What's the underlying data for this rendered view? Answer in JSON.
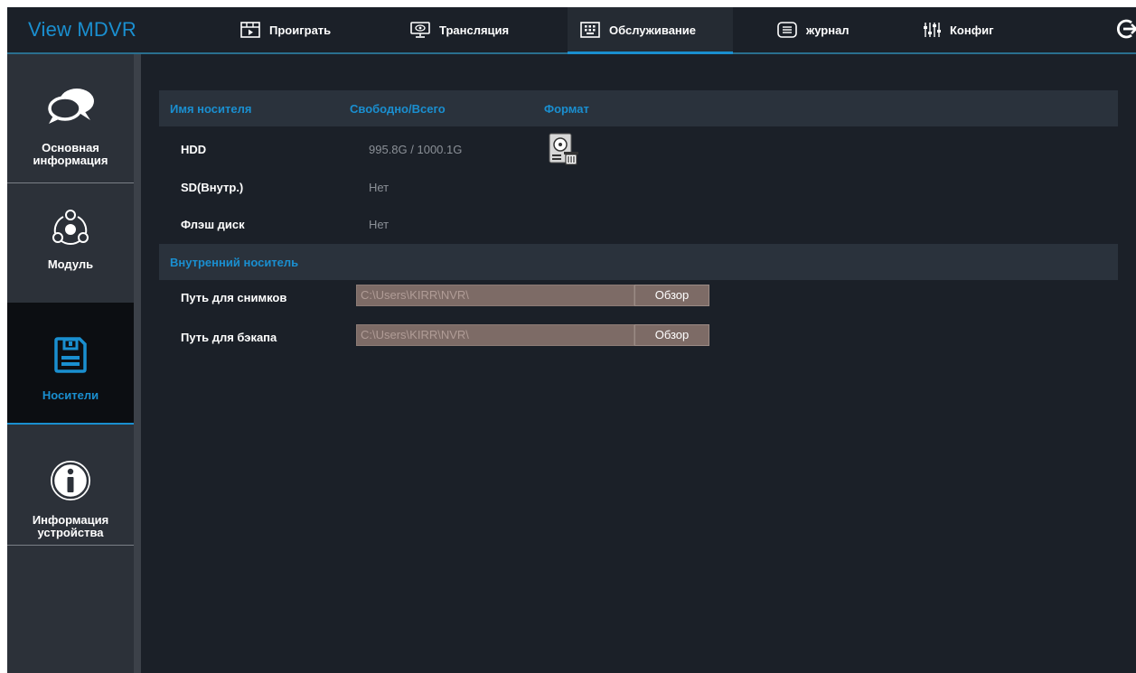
{
  "app": {
    "title": "View MDVR"
  },
  "nav": [
    {
      "label": "Проиграть",
      "icon": "play-film-icon"
    },
    {
      "label": "Трансляция",
      "icon": "monitor-icon"
    },
    {
      "label": "Обслуживание",
      "icon": "maintenance-grid-icon",
      "active": true
    },
    {
      "label": "журнал",
      "icon": "log-list-icon"
    },
    {
      "label": "Конфиг",
      "icon": "sliders-icon"
    }
  ],
  "sidebar": [
    {
      "label_line1": "Основная",
      "label_line2": "информация",
      "icon": "chat-bubbles-icon"
    },
    {
      "label_line1": "Модуль",
      "label_line2": "",
      "icon": "module-nodes-icon"
    },
    {
      "label_line1": "Носители",
      "label_line2": "",
      "icon": "floppy-disk-icon",
      "active": true
    },
    {
      "label_line1": "Информация",
      "label_line2": "устройства",
      "icon": "info-icon"
    }
  ],
  "storage_table": {
    "headers": {
      "name": "Имя носителя",
      "free_total": "Свободно/Всего",
      "format": "Формат"
    },
    "rows": [
      {
        "name": "HDD",
        "value": "995.8G / 1000.1G",
        "format_icon": "disk-format-icon"
      },
      {
        "name": "SD(Внутр.)",
        "value": "Нет"
      },
      {
        "name": "Флэш диск",
        "value": "Нет"
      }
    ]
  },
  "internal": {
    "header": "Внутренний носитель",
    "snapshot": {
      "label": "Путь для снимков",
      "value": "C:\\Users\\KIRR\\NVR\\",
      "button": "Обзор"
    },
    "backup": {
      "label": "Путь для бэкапа",
      "value": "C:\\Users\\KIRR\\NVR\\",
      "button": "Обзор"
    }
  },
  "colors": {
    "accent": "#1a8fd0",
    "background": "#1b2028",
    "sidebar": "#2c3139",
    "input": "#7d6b66"
  }
}
